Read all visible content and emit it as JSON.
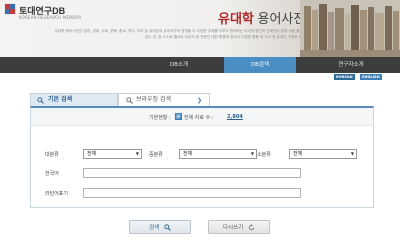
{
  "header": {
    "logo_title": "토대연구DB",
    "logo_subtitle": "KOREAN RESEARCH MEMORY",
    "dict_accent": "유대학",
    "dict_rest": " 용어사전",
    "description": "유대학 용어사전은 정치, 경제, 사회, 문화, 종교, 역사, 지리 등 유대인과 유대국가의 영역을 두 다양한 주제를 다루고 현대하는 다국적 활인과 관계인이 쉽게 사용 할 수 있는 것, 정 스스로 엘리트 요리의 한 전문인 대한 활용에 있어서 다양한 활용 등 지식 등 유대인 구성한 DB"
  },
  "nav": {
    "items": [
      {
        "label": "DB소개",
        "active": false
      },
      {
        "label": "DB검색",
        "active": true
      },
      {
        "label": "연구자소개",
        "active": false
      }
    ],
    "lang_korean": "KOREAN",
    "lang_english": "ENGLISH"
  },
  "tabs": {
    "basic_label": "기본 검색",
    "browse_label": "브라우징 검색"
  },
  "panel": {
    "count_label": "기본현황 :",
    "count_text": "전체 자료 수 :",
    "count_value": "2,804",
    "major_label": "대분류",
    "major_value": "전체",
    "middle_label": "중분류",
    "middle_value": "전체",
    "minor_label": "소분류",
    "minor_value": "전체",
    "korean_label": "한국어",
    "korean_value": "",
    "latin_label": "라틴어표기",
    "latin_value": ""
  },
  "buttons": {
    "search_label": "검색",
    "reset_label": "다시쓰기"
  },
  "colors": {
    "nav_bg": "#3d3d3d",
    "nav_active": "#4a8ec4",
    "accent_red": "#b02a2a",
    "link_blue": "#2a5f8f"
  }
}
